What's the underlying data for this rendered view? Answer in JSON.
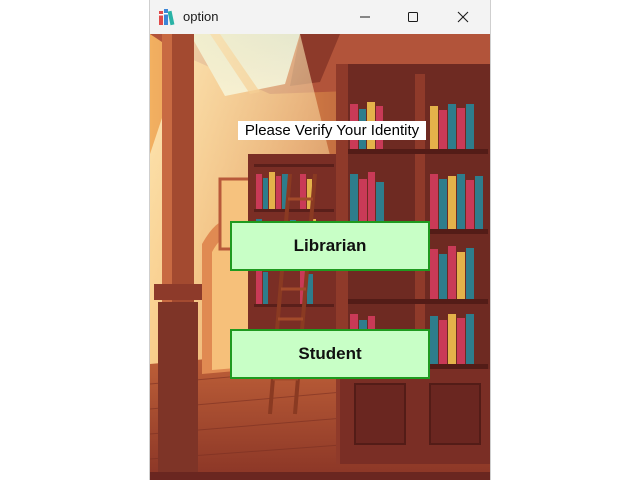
{
  "window": {
    "title": "option",
    "icon": "books-icon",
    "controls": {
      "minimize": "minimize-icon",
      "maximize": "maximize-icon",
      "close": "close-icon"
    }
  },
  "background": {
    "description_icon": "library-bookshelf-illustration"
  },
  "main": {
    "prompt": "Please Verify Your Identity",
    "buttons": [
      {
        "label": "Librarian"
      },
      {
        "label": "Student"
      }
    ]
  },
  "colors": {
    "button_fill": "#c8ffc6",
    "button_border": "#1f9a1f"
  }
}
